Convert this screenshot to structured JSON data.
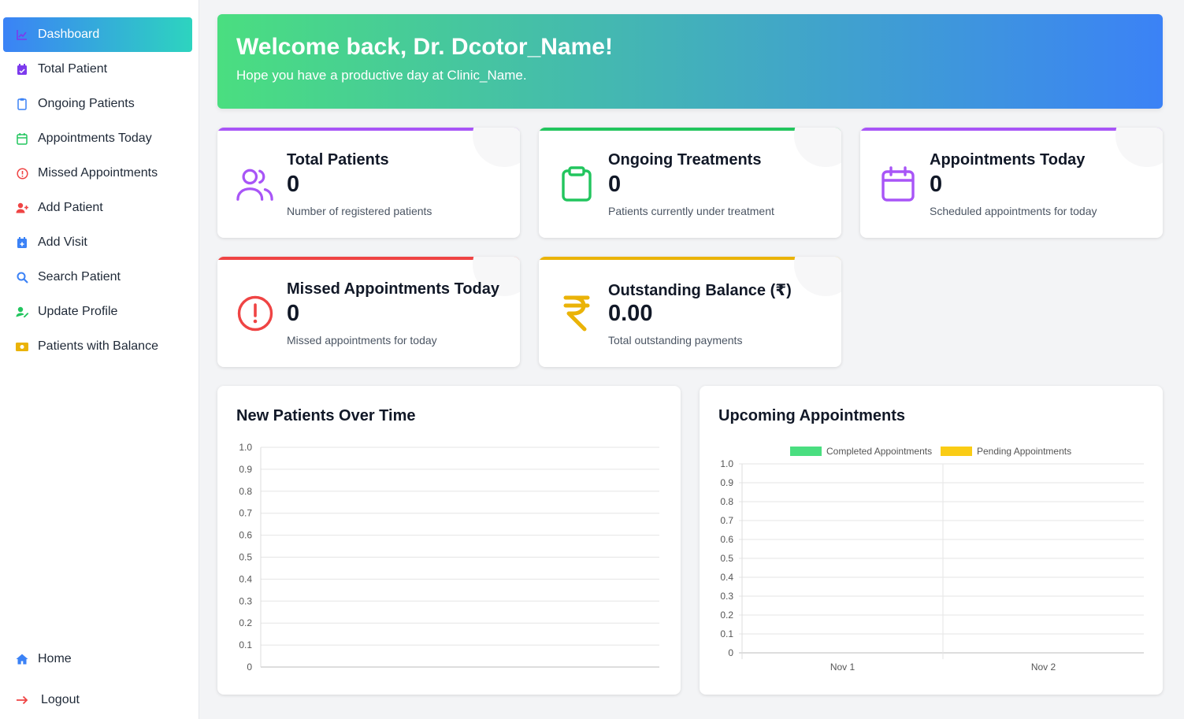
{
  "sidebar": {
    "items": [
      {
        "label": "Dashboard",
        "icon": "chart-icon",
        "color": "#7c3aed"
      },
      {
        "label": "Total Patient",
        "icon": "calendar-check-icon",
        "color": "#7c3aed"
      },
      {
        "label": "Ongoing Patients",
        "icon": "clipboard-icon",
        "color": "#3b82f6"
      },
      {
        "label": "Appointments Today",
        "icon": "calendar-icon",
        "color": "#22c55e"
      },
      {
        "label": "Missed Appointments",
        "icon": "alert-circle-icon",
        "color": "#ef4444"
      },
      {
        "label": "Add Patient",
        "icon": "user-plus-icon",
        "color": "#ef4444"
      },
      {
        "label": "Add Visit",
        "icon": "calendar-plus-icon",
        "color": "#3b82f6"
      },
      {
        "label": "Search Patient",
        "icon": "search-icon",
        "color": "#3b82f6"
      },
      {
        "label": "Update Profile",
        "icon": "user-edit-icon",
        "color": "#22c55e"
      },
      {
        "label": "Patients with Balance",
        "icon": "money-icon",
        "color": "#eab308"
      }
    ],
    "bottom": [
      {
        "label": "Home",
        "icon": "home-icon",
        "color": "#3b82f6"
      },
      {
        "label": "Logout",
        "icon": "arrow-right-icon",
        "color": "#ef4444"
      }
    ]
  },
  "banner": {
    "title": "Welcome back, Dr. Dcotor_Name!",
    "subtitle": "Hope you have a productive day at Clinic_Name."
  },
  "cards": [
    {
      "title": "Total Patients",
      "value": "0",
      "subtitle": "Number of registered patients",
      "accent": "#a855f7",
      "icon": "users-icon"
    },
    {
      "title": "Ongoing Treatments",
      "value": "0",
      "subtitle": "Patients currently under treatment",
      "accent": "#22c55e",
      "icon": "clipboard-icon"
    },
    {
      "title": "Appointments Today",
      "value": "0",
      "subtitle": "Scheduled appointments for today",
      "accent": "#a855f7",
      "icon": "calendar-icon"
    },
    {
      "title": "Missed Appointments Today",
      "value": "0",
      "subtitle": "Missed appointments for today",
      "accent": "#ef4444",
      "icon": "alert-circle-icon"
    },
    {
      "title": "Outstanding Balance (₹)",
      "value": "0.00",
      "subtitle": "Total outstanding payments",
      "accent": "#eab308",
      "icon": "rupee-icon"
    }
  ],
  "charts": {
    "new_patients_title": "New Patients Over Time",
    "upcoming_title": "Upcoming Appointments"
  },
  "chart_data": [
    {
      "type": "line",
      "title": "New Patients Over Time",
      "x": [],
      "series": [],
      "ylim": [
        0,
        1.0
      ],
      "yticks": [
        "1.0",
        "0.9",
        "0.8",
        "0.7",
        "0.6",
        "0.5",
        "0.4",
        "0.3",
        "0.2",
        "0.1",
        "0"
      ],
      "grid": true
    },
    {
      "type": "bar",
      "title": "Upcoming Appointments",
      "categories": [
        "Nov 1",
        "Nov 2"
      ],
      "series": [
        {
          "name": "Completed Appointments",
          "values": [
            0,
            0
          ],
          "color": "#4ade80"
        },
        {
          "name": "Pending Appointments",
          "values": [
            0,
            0
          ],
          "color": "#facc15"
        }
      ],
      "ylim": [
        0,
        1.0
      ],
      "yticks": [
        "1.0",
        "0.9",
        "0.8",
        "0.7",
        "0.6",
        "0.5",
        "0.4",
        "0.3",
        "0.2",
        "0.1",
        "0"
      ],
      "legend": "top",
      "grid": true
    }
  ]
}
